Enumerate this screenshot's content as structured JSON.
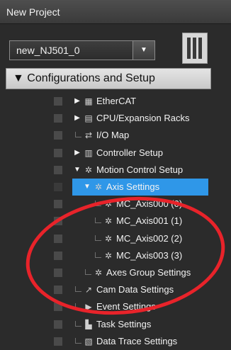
{
  "window": {
    "title": "New Project"
  },
  "controller_select": {
    "value": "new_NJ501_0"
  },
  "section": {
    "expander": "▼",
    "title": "Configurations and Setup"
  },
  "tree": [
    {
      "expander": "▶",
      "icon": "grid-icon",
      "label": "EtherCAT"
    },
    {
      "expander": "▶",
      "icon": "rack-icon",
      "label": "CPU/Expansion Racks"
    },
    {
      "expander": "",
      "icon": "io-map-icon",
      "label": "I/O Map"
    },
    {
      "expander": "▶",
      "icon": "controller-icon",
      "label": "Controller Setup"
    },
    {
      "expander": "▼",
      "icon": "gear-icon",
      "label": "Motion Control Setup"
    },
    {
      "expander": "▼",
      "icon": "gear-icon",
      "label": "Axis Settings",
      "selected": true
    },
    {
      "expander": "",
      "icon": "gear-icon",
      "label": "MC_Axis000 (0)"
    },
    {
      "expander": "",
      "icon": "gear-icon",
      "label": "MC_Axis001 (1)"
    },
    {
      "expander": "",
      "icon": "gear-icon",
      "label": "MC_Axis002 (2)"
    },
    {
      "expander": "",
      "icon": "gear-icon",
      "label": "MC_Axis003 (3)"
    },
    {
      "expander": "",
      "icon": "gear-group-icon",
      "label": "Axes Group Settings"
    },
    {
      "expander": "",
      "icon": "cam-icon",
      "label": "Cam Data Settings"
    },
    {
      "expander": "",
      "icon": "event-icon",
      "label": "Event Settings"
    },
    {
      "expander": "",
      "icon": "task-icon",
      "label": "Task Settings"
    },
    {
      "expander": "",
      "icon": "trace-icon",
      "label": "Data Trace Settings"
    }
  ],
  "colors": {
    "background": "#2b2b2b",
    "selection": "#2f97e8",
    "annotation": "#e8232a"
  }
}
